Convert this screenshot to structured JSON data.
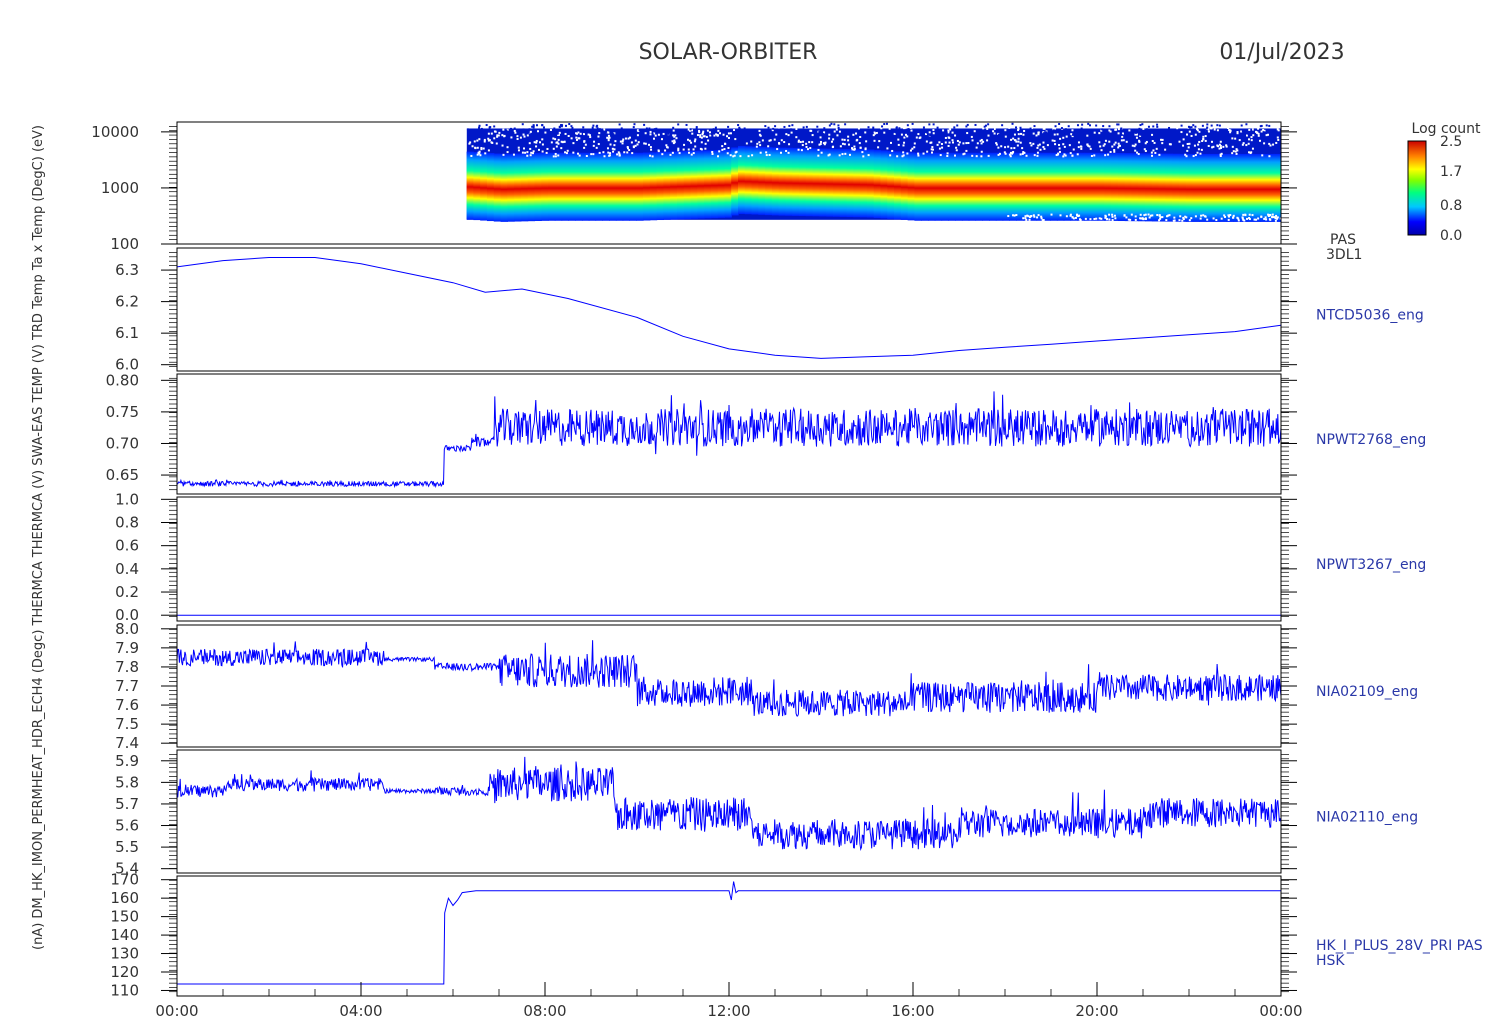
{
  "header": {
    "mission": "SOLAR-ORBITER",
    "date": "01/Jul/2023"
  },
  "overlapping_ylabel": "(nA) DM_HK_IMON_PERMHEAT_HDR_ECH4 (Degc) THERMCA THERMCA (V) SWA-EAS TEMP (V) TRD Temp Ta x Temp (DegC) (eV)",
  "colors": {
    "trace": "#0000ff",
    "axis": "#000000",
    "channel_label": "#2a38a8"
  },
  "chart_data": [
    {
      "type": "heatmap",
      "channel": "PAS",
      "channel2": "3DL1",
      "ylabel": "(eV)",
      "yscale": "log",
      "ylim": [
        100,
        15000
      ],
      "yticks": [
        "100",
        "1000",
        "10000"
      ],
      "colorbar_title": "Log count",
      "colorbar_ticks": [
        "0.0",
        "0.8",
        "1.7",
        "2.5"
      ],
      "colorbar_range": [
        0.0,
        2.5
      ],
      "data_start_hour": 6.3,
      "band_center_eV": [
        [
          6.3,
          1100
        ],
        [
          7.0,
          1000
        ],
        [
          8.0,
          1050
        ],
        [
          10.0,
          1050
        ],
        [
          12.0,
          1200
        ],
        [
          12.1,
          1400
        ],
        [
          13.0,
          1300
        ],
        [
          15.0,
          1200
        ],
        [
          16.0,
          1050
        ],
        [
          18.0,
          1050
        ],
        [
          20.0,
          1050
        ],
        [
          22.0,
          1000
        ],
        [
          24.0,
          1000
        ]
      ]
    },
    {
      "type": "line",
      "channel": "NTCD5036_eng",
      "ylim": [
        5.98,
        6.37
      ],
      "yticks": [
        "6.0",
        "6.1",
        "6.2",
        "6.3"
      ],
      "x": [
        0,
        1,
        2,
        3,
        4,
        5,
        6,
        6.7,
        7.5,
        8.5,
        10,
        11,
        12,
        13,
        14,
        15,
        16,
        17,
        18,
        19,
        20,
        21,
        22,
        23,
        24
      ],
      "values": [
        6.31,
        6.33,
        6.34,
        6.34,
        6.32,
        6.29,
        6.26,
        6.23,
        6.24,
        6.21,
        6.15,
        6.09,
        6.05,
        6.03,
        6.02,
        6.025,
        6.03,
        6.045,
        6.055,
        6.065,
        6.075,
        6.085,
        6.095,
        6.105,
        6.125
      ]
    },
    {
      "type": "line",
      "channel": "NPWT2768_eng",
      "ylim": [
        0.62,
        0.81
      ],
      "yticks": [
        "0.65",
        "0.70",
        "0.75",
        "0.80"
      ],
      "segments": [
        {
          "x0": 0,
          "x1": 5.8,
          "base": 0.636,
          "noise": 0.004
        },
        {
          "x0": 5.8,
          "x1": 6.4,
          "base": 0.692,
          "noise": 0.005
        },
        {
          "x0": 6.4,
          "x1": 6.9,
          "base": 0.702,
          "noise": 0.008
        },
        {
          "x0": 6.9,
          "x1": 24,
          "base": 0.725,
          "noise": 0.03
        }
      ]
    },
    {
      "type": "line",
      "channel": "NPWT3267_eng",
      "ylim": [
        -0.05,
        1.02
      ],
      "yticks": [
        "0.0",
        "0.2",
        "0.4",
        "0.6",
        "0.8",
        "1.0"
      ],
      "x": [
        0,
        24
      ],
      "values": [
        0.0,
        0.0
      ]
    },
    {
      "type": "line",
      "channel": "NIA02109_eng",
      "ylim": [
        7.38,
        8.02
      ],
      "yticks": [
        "7.4",
        "7.5",
        "7.6",
        "7.7",
        "7.8",
        "7.9",
        "8.0"
      ],
      "segments": [
        {
          "x0": 0,
          "x1": 4.5,
          "base": 7.85,
          "noise": 0.045
        },
        {
          "x0": 4.5,
          "x1": 5.6,
          "base": 7.84,
          "noise": 0.01
        },
        {
          "x0": 5.6,
          "x1": 7.0,
          "base": 7.8,
          "noise": 0.02
        },
        {
          "x0": 7.0,
          "x1": 10.0,
          "base": 7.78,
          "noise": 0.09
        },
        {
          "x0": 10.0,
          "x1": 12.5,
          "base": 7.67,
          "noise": 0.08
        },
        {
          "x0": 12.5,
          "x1": 16.0,
          "base": 7.61,
          "noise": 0.07
        },
        {
          "x0": 16.0,
          "x1": 20.0,
          "base": 7.64,
          "noise": 0.08
        },
        {
          "x0": 20.0,
          "x1": 24,
          "base": 7.69,
          "noise": 0.07
        }
      ]
    },
    {
      "type": "line",
      "channel": "NIA02110_eng",
      "ylim": [
        5.38,
        5.95
      ],
      "yticks": [
        "5.4",
        "5.5",
        "5.6",
        "5.7",
        "5.8",
        "5.9"
      ],
      "segments": [
        {
          "x0": 0,
          "x1": 1.0,
          "base": 5.76,
          "noise": 0.03
        },
        {
          "x0": 1.0,
          "x1": 4.5,
          "base": 5.79,
          "noise": 0.03
        },
        {
          "x0": 4.5,
          "x1": 5.6,
          "base": 5.76,
          "noise": 0.01
        },
        {
          "x0": 5.6,
          "x1": 6.8,
          "base": 5.76,
          "noise": 0.02
        },
        {
          "x0": 6.8,
          "x1": 9.5,
          "base": 5.79,
          "noise": 0.08
        },
        {
          "x0": 9.5,
          "x1": 12.5,
          "base": 5.65,
          "noise": 0.08
        },
        {
          "x0": 12.5,
          "x1": 17.0,
          "base": 5.56,
          "noise": 0.07
        },
        {
          "x0": 17.0,
          "x1": 21.0,
          "base": 5.61,
          "noise": 0.07
        },
        {
          "x0": 21.0,
          "x1": 24,
          "base": 5.66,
          "noise": 0.07
        }
      ]
    },
    {
      "type": "line",
      "channel": "HK_I_PLUS_28V_PRI PAS",
      "channel2": "HSK",
      "ylabel": "(nA)",
      "ylim": [
        107,
        172
      ],
      "yticks": [
        "110",
        "120",
        "130",
        "140",
        "150",
        "160",
        "170"
      ],
      "x": [
        0,
        5.8,
        5.82,
        5.9,
        6.0,
        6.1,
        6.2,
        6.5,
        12.0,
        12.05,
        12.1,
        12.15,
        12.2,
        24
      ],
      "values": [
        113.5,
        113.5,
        152,
        160,
        156,
        159,
        163,
        164,
        164,
        159,
        169,
        163,
        164,
        164
      ]
    }
  ],
  "xaxis": {
    "range_hours": [
      0,
      24
    ],
    "tick_labels": [
      "00:00",
      "04:00",
      "08:00",
      "12:00",
      "16:00",
      "20:00",
      "00:00"
    ]
  }
}
